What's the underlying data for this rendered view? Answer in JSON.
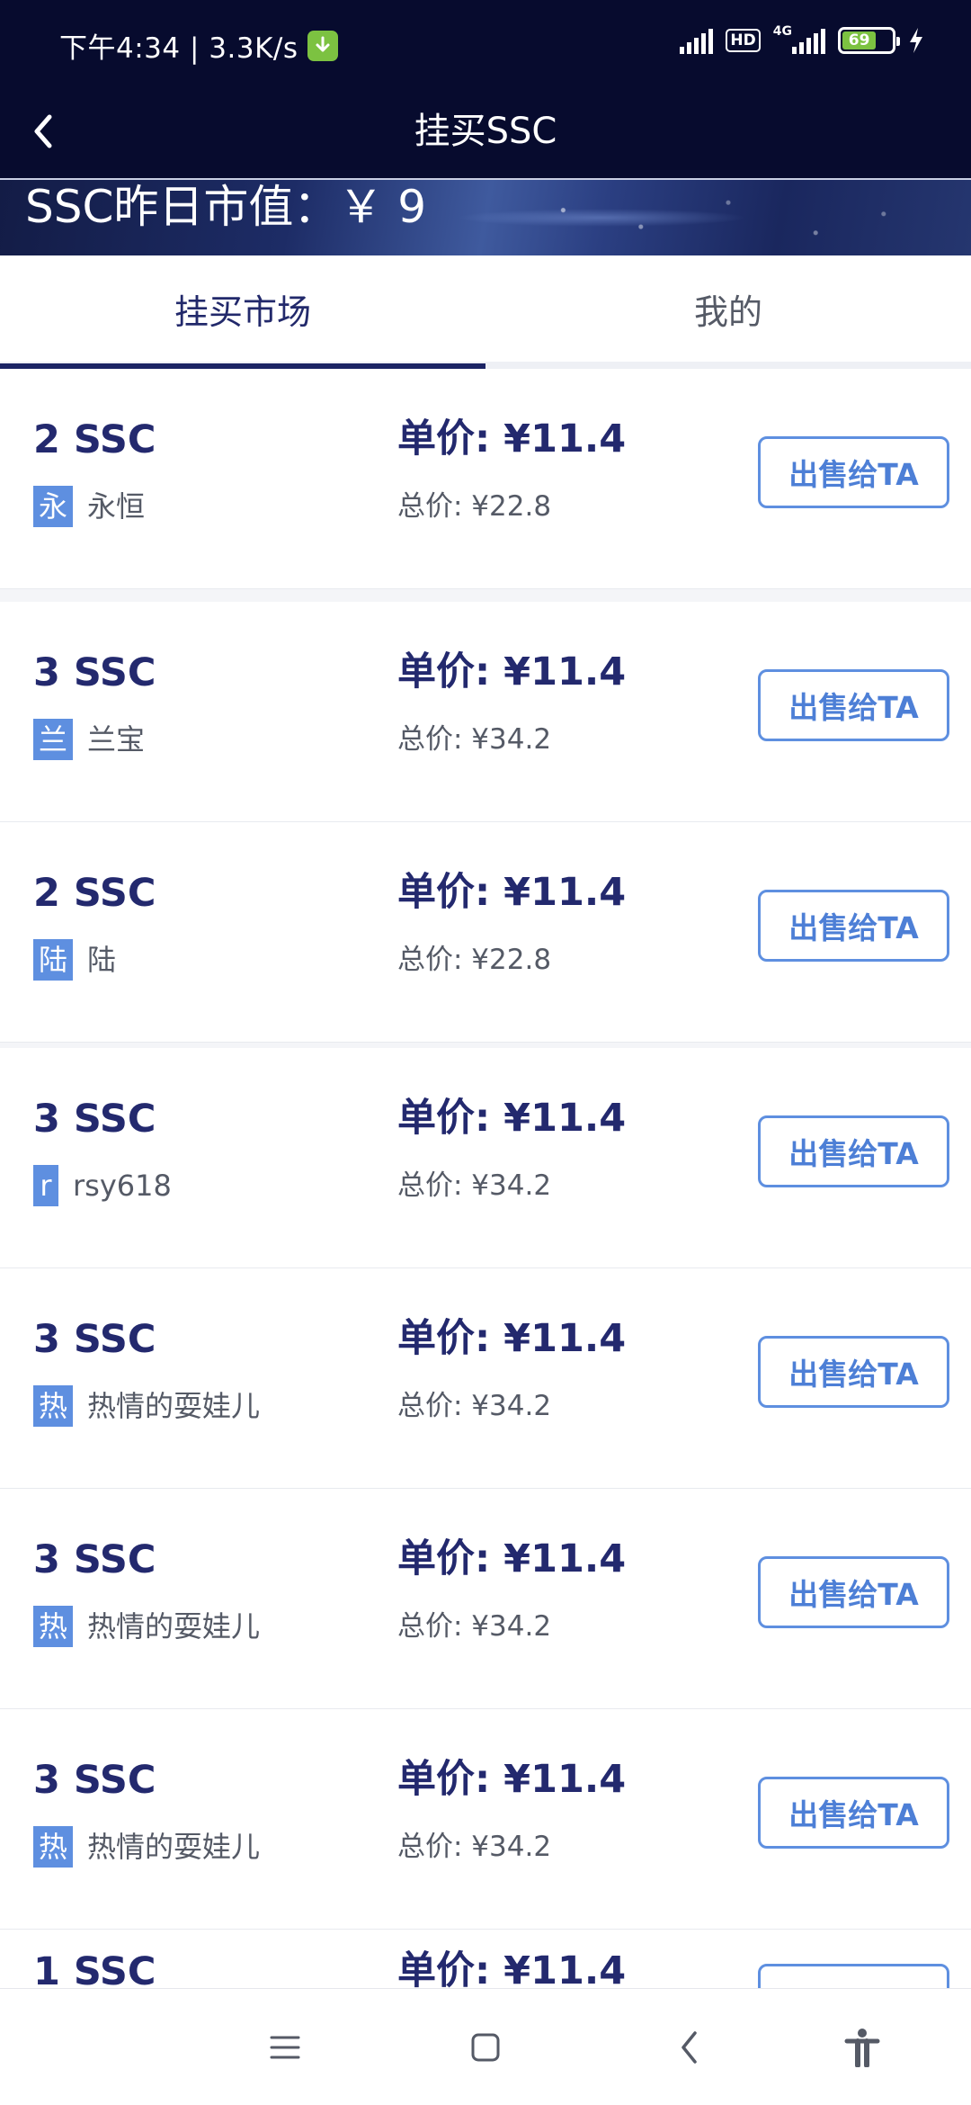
{
  "status_bar": {
    "time_speed": "下午4:34 | 3.3K/s",
    "hd_label": "HD",
    "network_label": "4G",
    "battery_level": "69",
    "battery_fraction": 0.69
  },
  "header": {
    "title": "挂买SSC"
  },
  "banner": {
    "text": "SSC昨日市值：￥ 9"
  },
  "tabs": [
    {
      "label": "挂买市场",
      "active": true
    },
    {
      "label": "我的",
      "active": false
    }
  ],
  "listings": [
    {
      "qty": "2 SSC",
      "badge": "永",
      "seller": "永恒",
      "unit_price": "单价: ¥11.4",
      "total_price": "总价: ¥22.8",
      "action": "出售给TA"
    },
    {
      "qty": "3 SSC",
      "badge": "兰",
      "seller": "兰宝",
      "unit_price": "单价: ¥11.4",
      "total_price": "总价: ¥34.2",
      "action": "出售给TA"
    },
    {
      "qty": "2 SSC",
      "badge": "陆",
      "seller": "陆",
      "unit_price": "单价: ¥11.4",
      "total_price": "总价: ¥22.8",
      "action": "出售给TA"
    },
    {
      "qty": "3 SSC",
      "badge": "r",
      "seller": "rsy618",
      "unit_price": "单价: ¥11.4",
      "total_price": "总价: ¥34.2",
      "action": "出售给TA"
    },
    {
      "qty": "3 SSC",
      "badge": "热",
      "seller": "热情的耍娃儿",
      "unit_price": "单价: ¥11.4",
      "total_price": "总价: ¥34.2",
      "action": "出售给TA"
    },
    {
      "qty": "3 SSC",
      "badge": "热",
      "seller": "热情的耍娃儿",
      "unit_price": "单价: ¥11.4",
      "total_price": "总价: ¥34.2",
      "action": "出售给TA"
    },
    {
      "qty": "3 SSC",
      "badge": "热",
      "seller": "热情的耍娃儿",
      "unit_price": "单价: ¥11.4",
      "total_price": "总价: ¥34.2",
      "action": "出售给TA"
    },
    {
      "qty": "1 SSC",
      "badge": "",
      "seller": "",
      "unit_price": "单价: ¥11.4",
      "total_price": "",
      "action": ""
    }
  ],
  "icons": {
    "back": "chevron-left-icon",
    "menu": "menu-lines-icon",
    "home": "square-home-icon",
    "sys_back": "triangle-back-icon",
    "accessibility": "accessibility-person-icon"
  },
  "colors": {
    "header_bg": "#070b2e",
    "primary_text": "#23296e",
    "accent_blue": "#5e8fe0",
    "battery_green": "#7cc241"
  }
}
